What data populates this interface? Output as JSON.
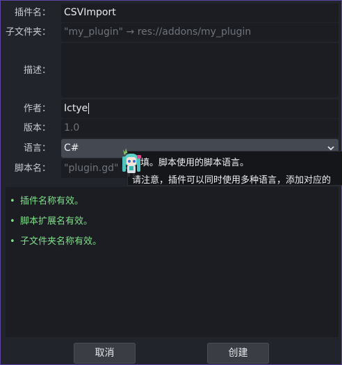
{
  "form": {
    "plugin_name": {
      "label": "插件名：",
      "value": "CSVImport"
    },
    "subfolder": {
      "label": "子文件夹：",
      "placeholder": "\"my_plugin\" → res://addons/my_plugin"
    },
    "description": {
      "label": "描述：",
      "value": ""
    },
    "author": {
      "label": "作者：",
      "value": "Ictye"
    },
    "version": {
      "label": "版本：",
      "placeholder": "1.0"
    },
    "language": {
      "label": "语言：",
      "value": "C#"
    },
    "script_name": {
      "label": "脚本名：",
      "placeholder": "\"plugin.gd\" →"
    }
  },
  "tooltip": {
    "line1": "填。脚本使用的脚本语言。",
    "line2": "请注意，插件可以同时使用多种语言，添加对应的"
  },
  "validation": [
    {
      "bullet": "•",
      "text": "插件名称有效。"
    },
    {
      "bullet": "•",
      "text": "脚本扩展名有效。"
    },
    {
      "bullet": "•",
      "text": "子文件夹名称有效。"
    }
  ],
  "buttons": {
    "cancel": "取消",
    "create": "创建"
  },
  "icons": {
    "dropdown": "chevron-down-icon",
    "mascot": "mascot-icon"
  },
  "colors": {
    "background": "#22242b",
    "field": "#1b1d22",
    "select": "#444850",
    "valid_text": "#7fe08a",
    "window_border": "#5b46a3"
  }
}
